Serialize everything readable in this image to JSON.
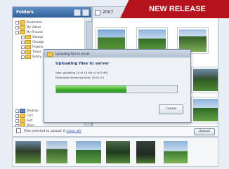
{
  "banner": {
    "word1": "NEW",
    "word2": " RELEASE"
  },
  "folders_pane": {
    "title": "Folders",
    "tree": [
      {
        "label": "Bookmarks",
        "color": "yellow"
      },
      {
        "label": "My Videos",
        "color": "yellow"
      },
      {
        "label": "My Pictures",
        "color": "yellow"
      },
      {
        "label": "Vintage",
        "color": "yellow"
      },
      {
        "label": "Chicago",
        "color": "yellow"
      },
      {
        "label": "Flowers",
        "color": "yellow"
      },
      {
        "label": "Travel",
        "color": "yellow"
      },
      {
        "label": "Family",
        "color": "yellow"
      },
      {
        "label": "Desktop",
        "color": "blue"
      },
      {
        "label": "Cars",
        "color": "yellow"
      },
      {
        "label": "Golf",
        "color": "yellow"
      },
      {
        "label": "Drive",
        "color": "yellow"
      }
    ]
  },
  "photos_pane": {
    "title": "2007"
  },
  "dialog": {
    "title": "Uploading files to server",
    "heading": "Uploading files to server",
    "line1": "Now uploading 10 of 18 file (4 of 6 MB)",
    "line2": "Estimated remaining time: 00:01:23",
    "progress": 0.58,
    "cancel_label": "Cancel"
  },
  "status": {
    "text": "Files selected to upload: 6 ",
    "link": "(clear all)",
    "upload_label": "Upload"
  },
  "colors": {
    "banner": "#b5121b",
    "progress": "#3fae2b",
    "titlebar": "#2e5f9a"
  }
}
